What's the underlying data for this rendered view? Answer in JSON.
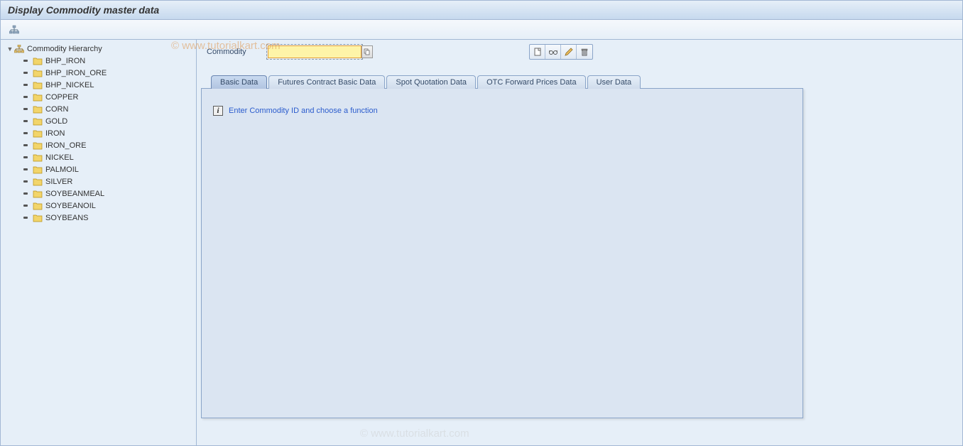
{
  "title": "Display Commodity master data",
  "watermark": "© www.tutorialkart.com",
  "sidebar": {
    "root_label": "Commodity Hierarchy",
    "items": [
      "BHP_IRON",
      "BHP_IRON_ORE",
      "BHP_NICKEL",
      "COPPER",
      "CORN",
      "GOLD",
      "IRON",
      "IRON_ORE",
      "NICKEL",
      "PALMOIL",
      "SILVER",
      "SOYBEANMEAL",
      "SOYBEANOIL",
      "SOYBEANS"
    ]
  },
  "form": {
    "commodity_label": "Commodity",
    "commodity_value": ""
  },
  "tabs": [
    "Basic Data",
    "Futures Contract Basic Data",
    "Spot Quotation Data",
    "OTC Forward Prices Data",
    "User Data"
  ],
  "active_tab_index": 0,
  "panel": {
    "info_text": "Enter Commodity ID and choose a function"
  },
  "icons": {
    "hierarchy": "hierarchy-icon",
    "folder": "folder-icon",
    "display": "display-icon",
    "change": "glasses-icon",
    "create": "pencil-icon",
    "delete": "trash-icon",
    "search_help": "search-help-icon",
    "toolbar_struct": "structure-icon"
  }
}
